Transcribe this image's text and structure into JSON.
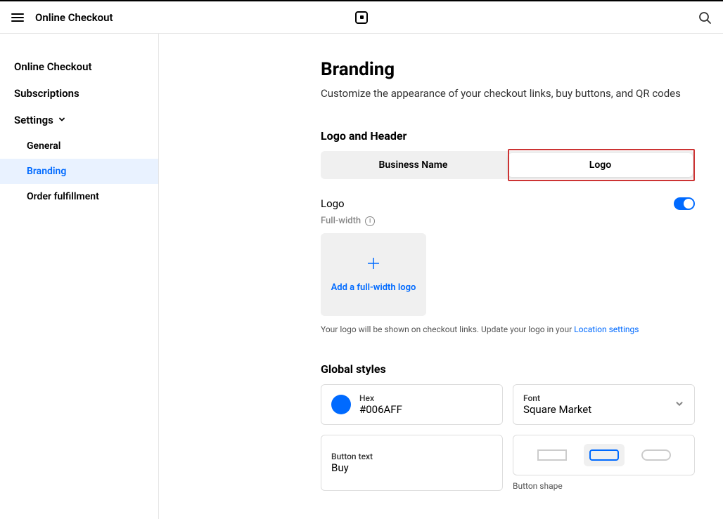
{
  "topbar": {
    "title": "Online Checkout"
  },
  "sidebar": {
    "items": [
      {
        "label": "Online Checkout"
      },
      {
        "label": "Subscriptions"
      },
      {
        "label": "Settings"
      }
    ],
    "subitems": [
      {
        "label": "General"
      },
      {
        "label": "Branding"
      },
      {
        "label": "Order fulfillment"
      }
    ]
  },
  "page": {
    "title": "Branding",
    "subtitle": "Customize the appearance of your checkout links, buy buttons, and QR codes"
  },
  "logo_header": {
    "section_title": "Logo and Header",
    "option_a": "Business Name",
    "option_b": "Logo",
    "logo_label": "Logo",
    "full_width_label": "Full-width",
    "upload_text": "Add a full-width logo",
    "hint_prefix": "Your logo will be shown on checkout links. Update your logo in your ",
    "hint_link": "Location settings"
  },
  "global_styles": {
    "section_title": "Global styles",
    "hex_label": "Hex",
    "hex_value": "#006AFF",
    "font_label": "Font",
    "font_value": "Square Market",
    "button_text_label": "Button text",
    "button_text_value": "Buy",
    "button_shape_label": "Button shape"
  }
}
